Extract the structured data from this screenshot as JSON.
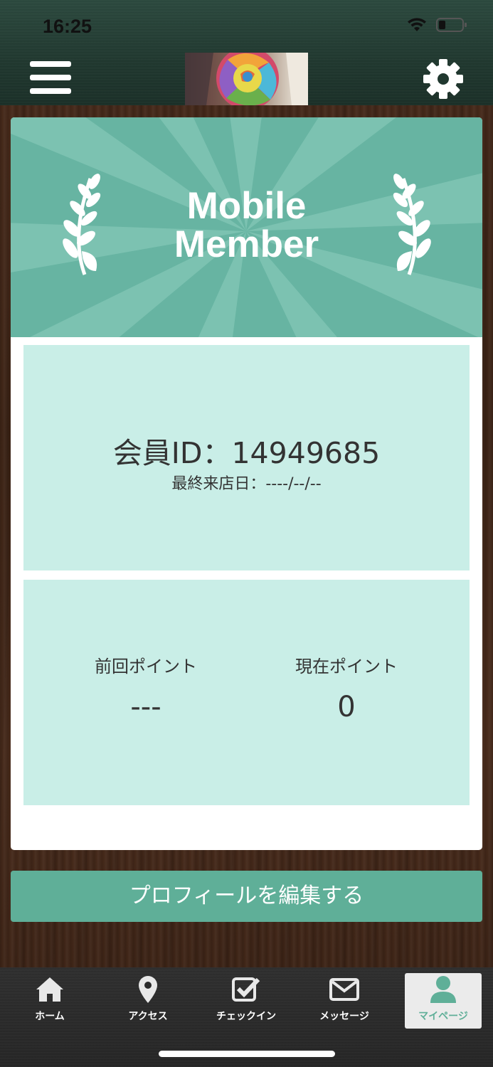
{
  "status_bar": {
    "time": "16:25"
  },
  "header": {
    "menu_icon": "hamburger-menu-icon",
    "logo": "rainbow-rose-logo",
    "settings_icon": "gear-icon"
  },
  "banner": {
    "title": "Mobile\nMember",
    "accent_color": "#67b4a2"
  },
  "member": {
    "id_line": "会員ID：14949685",
    "last_visit_line": "最終来店日：----/--/--"
  },
  "points": {
    "previous_label": "前回ポイント",
    "previous_value": "---",
    "current_label": "現在ポイント",
    "current_value": "0"
  },
  "edit_profile_label": "プロフィールを編集する",
  "tabs": [
    {
      "label": "ホーム",
      "icon": "home-icon"
    },
    {
      "label": "アクセス",
      "icon": "map-pin-icon"
    },
    {
      "label": "チェックイン",
      "icon": "checkbox-icon"
    },
    {
      "label": "メッセージ",
      "icon": "envelope-icon"
    },
    {
      "label": "マイページ",
      "icon": "user-icon",
      "active": true
    }
  ],
  "colors": {
    "panel_bg": "#c9eee7",
    "button_bg": "#5faf98",
    "active_tab_text": "#5faf98"
  }
}
